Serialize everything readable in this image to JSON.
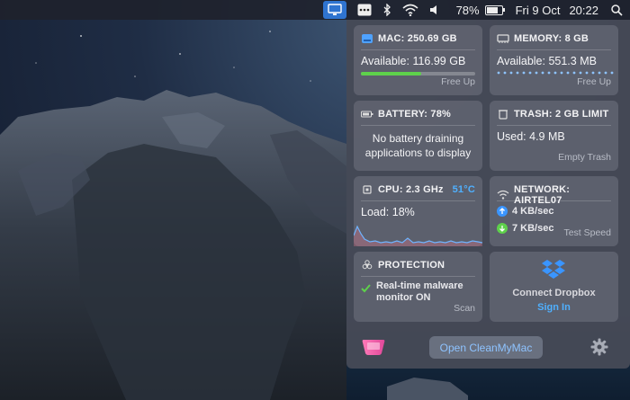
{
  "menubar": {
    "battery_percent": "78%",
    "battery_level": 0.78,
    "date": "Fri 9 Oct",
    "time": "20:22",
    "icons": [
      "cleanmymac-icon",
      "menu-dots-icon",
      "bluetooth-icon",
      "wifi-icon",
      "volume-icon",
      "battery-icon",
      "search-icon"
    ]
  },
  "mac": {
    "title": "MAC: 250.69 GB",
    "available": "Available: 116.99 GB",
    "used_fraction": 0.53,
    "action": "Free Up"
  },
  "memory": {
    "title": "MEMORY: 8 GB",
    "available": "Available: 551.3 MB",
    "action": "Free Up"
  },
  "battery": {
    "title": "BATTERY: 78%",
    "message": "No battery draining applications to display"
  },
  "trash": {
    "title": "TRASH: 2 GB LIMIT",
    "used": "Used: 4.9 MB",
    "action": "Empty Trash"
  },
  "cpu": {
    "title": "CPU: 2.3 GHz",
    "temp": "51°C",
    "load": "Load: 18%"
  },
  "network": {
    "title": "NETWORK: AIRTEL07",
    "upload": "4 KB/sec",
    "download": "7 KB/sec",
    "action": "Test Speed"
  },
  "protection": {
    "title": "PROTECTION",
    "status": "Real-time malware monitor ON",
    "action": "Scan"
  },
  "dropbox": {
    "title": "Connect Dropbox",
    "action": "Sign In"
  },
  "footer": {
    "open_label": "Open CleanMyMac"
  },
  "colors": {
    "accent": "#3a95ff",
    "temp": "#4fb0ff",
    "green": "#5ed14b",
    "popup_bg": "#464a56"
  }
}
